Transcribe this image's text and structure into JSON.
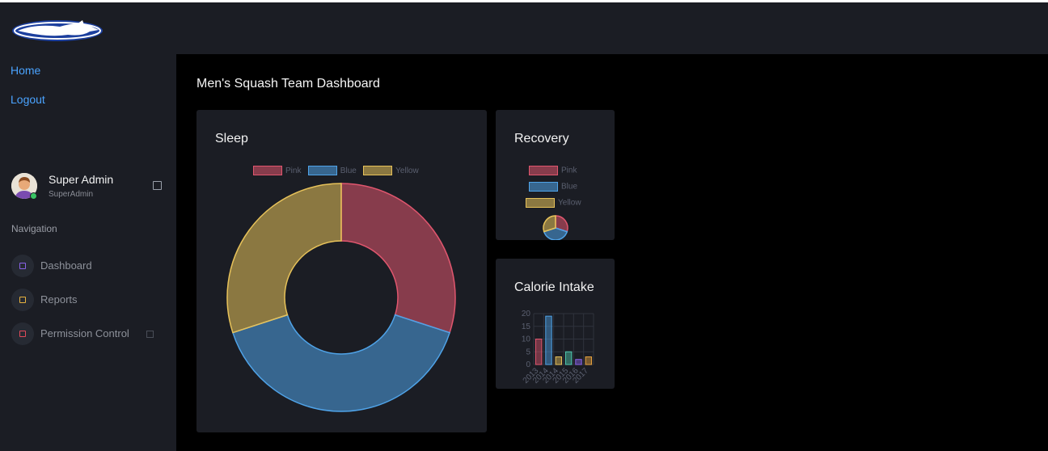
{
  "header": {
    "logo_icon": "horse-logo-icon"
  },
  "sidebar": {
    "links": [
      {
        "label": "Home"
      },
      {
        "label": "Logout"
      }
    ],
    "user": {
      "name": "Super Admin",
      "role": "SuperAdmin"
    },
    "nav_heading": "Navigation",
    "nav_items": [
      {
        "label": "Dashboard",
        "icon": "square-icon",
        "color": "#8a63e8"
      },
      {
        "label": "Reports",
        "icon": "square-icon",
        "color": "#e8b33f"
      },
      {
        "label": "Permission Control",
        "icon": "square-icon",
        "color": "#e24a5a"
      }
    ]
  },
  "main": {
    "title": "Men's Squash Team Dashboard"
  },
  "colors": {
    "pink": "#e0566e",
    "blue": "#4fa3e8",
    "yellow": "#e7c25a"
  },
  "cards": {
    "sleep": {
      "title": "Sleep"
    },
    "recovery": {
      "title": "Recovery"
    },
    "calories": {
      "title": "Calorie Intake"
    }
  },
  "chart_data": [
    {
      "type": "pie",
      "variant": "doughnut",
      "title": "Sleep",
      "labels": [
        "Pink",
        "Blue",
        "Yellow"
      ],
      "values": [
        30,
        40,
        30
      ],
      "legend": "top"
    },
    {
      "type": "pie",
      "title": "Recovery",
      "labels": [
        "Pink",
        "Blue",
        "Yellow"
      ],
      "values": [
        30,
        40,
        30
      ],
      "legend": "top"
    },
    {
      "type": "bar",
      "title": "Calorie Intake",
      "categories": [
        "2013",
        "2014",
        "2014",
        "2015",
        "2016",
        "2017"
      ],
      "values": [
        10,
        19,
        3,
        5,
        2,
        3
      ],
      "ylim": [
        0,
        20
      ],
      "yticks": [
        "20",
        "15",
        "10",
        "5",
        "0"
      ],
      "grid": true
    }
  ]
}
